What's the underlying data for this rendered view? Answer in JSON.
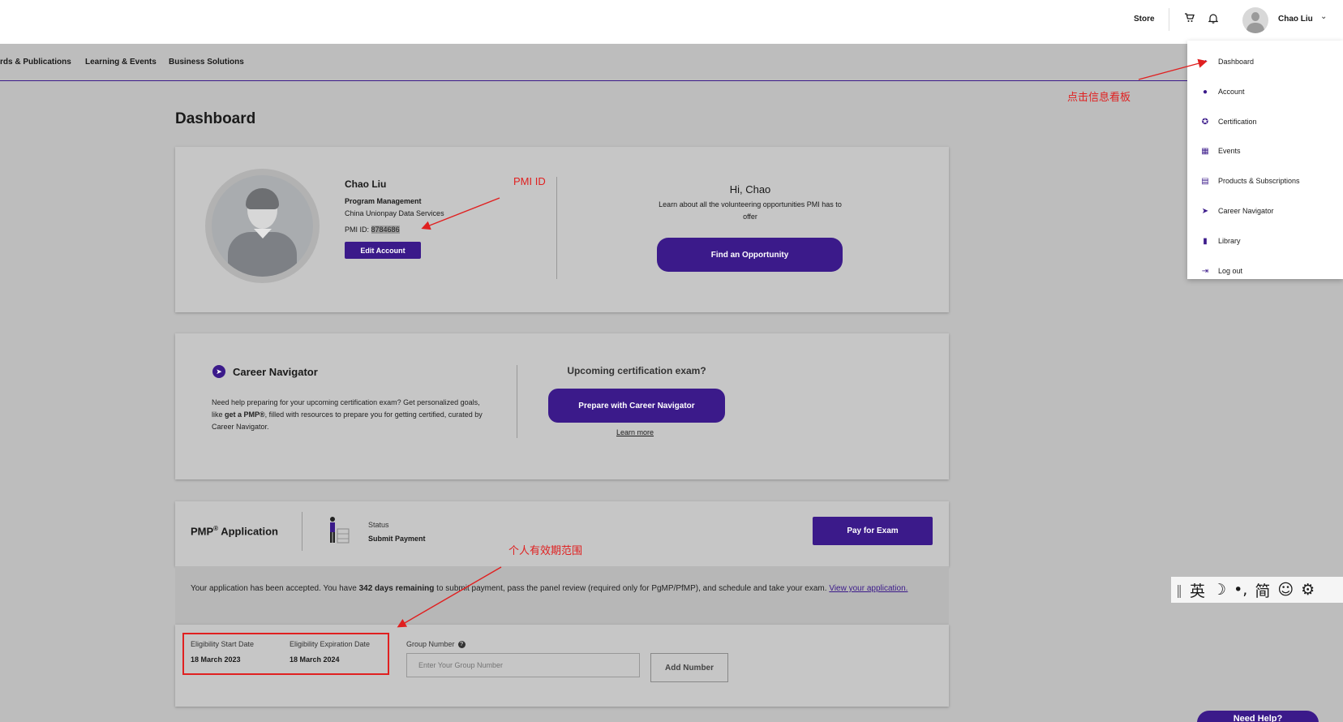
{
  "header": {
    "store_label": "Store",
    "user_name": "Chao Liu",
    "cart_icon": "cart-icon",
    "bell_icon": "bell-icon"
  },
  "nav": {
    "items": [
      "rds & Publications",
      "Learning & Events",
      "Business Solutions"
    ]
  },
  "page": {
    "title": "Dashboard"
  },
  "profile": {
    "name": "Chao Liu",
    "title": "Program Management",
    "company": "China Unionpay Data Services",
    "pmi_id_label": "PMI ID:",
    "pmi_id_value": "8784686",
    "edit_button": "Edit Account"
  },
  "volunteer": {
    "greeting": "Hi, Chao",
    "text": "Learn about all the volunteering opportunities PMI has to offer",
    "button": "Find an Opportunity"
  },
  "career": {
    "title": "Career Navigator",
    "text_before": "Need help preparing for your upcoming certification exam? Get personalized goals, like ",
    "text_bold": "get a PMP®",
    "text_after": ", filled with resources to prepare you for getting certified, curated by Career Navigator.",
    "upcoming": "Upcoming certification exam?",
    "button": "Prepare with Career Navigator",
    "learn_more": "Learn more"
  },
  "application": {
    "title_prefix": "PMP",
    "title_reg": "®",
    "title_suffix": "Application",
    "status_label": "Status",
    "status_value": "Submit Payment",
    "pay_button": "Pay for Exam",
    "message_before": "Your application has been accepted. You have ",
    "message_bold": "342 days remaining",
    "message_after": " to submit payment, pass the panel review (required only for PgMP/PfMP), and schedule and take your exam. ",
    "message_link": "View your application.",
    "eligibility_start_label": "Eligibility Start Date",
    "eligibility_start_value": "18 March 2023",
    "eligibility_end_label": "Eligibility Expiration Date",
    "eligibility_end_value": "18 March 2024",
    "group_number_label": "Group Number",
    "group_number_placeholder": "Enter Your Group Number",
    "add_button": "Add Number"
  },
  "dropdown": {
    "items": [
      {
        "label": "Dashboard",
        "icon": "dashboard-icon"
      },
      {
        "label": "Account",
        "icon": "account-icon"
      },
      {
        "label": "Certification",
        "icon": "certification-icon"
      },
      {
        "label": "Events",
        "icon": "events-icon"
      },
      {
        "label": "Products & Subscriptions",
        "icon": "products-icon"
      },
      {
        "label": "Career Navigator",
        "icon": "career-navigator-icon"
      },
      {
        "label": "Library",
        "icon": "library-icon"
      },
      {
        "label": "Log out",
        "icon": "logout-icon"
      }
    ]
  },
  "annotations": {
    "pmi_id": "PMI ID",
    "dashboard_hint": "点击信息看板",
    "validity_hint": "个人有效期范围"
  },
  "ime_toolbar": {
    "lang": "英",
    "simplified": "简"
  },
  "help_button": "Need Help?",
  "colors": {
    "brand_purple": "#3b1a8a",
    "annotation_red": "#e02020"
  }
}
